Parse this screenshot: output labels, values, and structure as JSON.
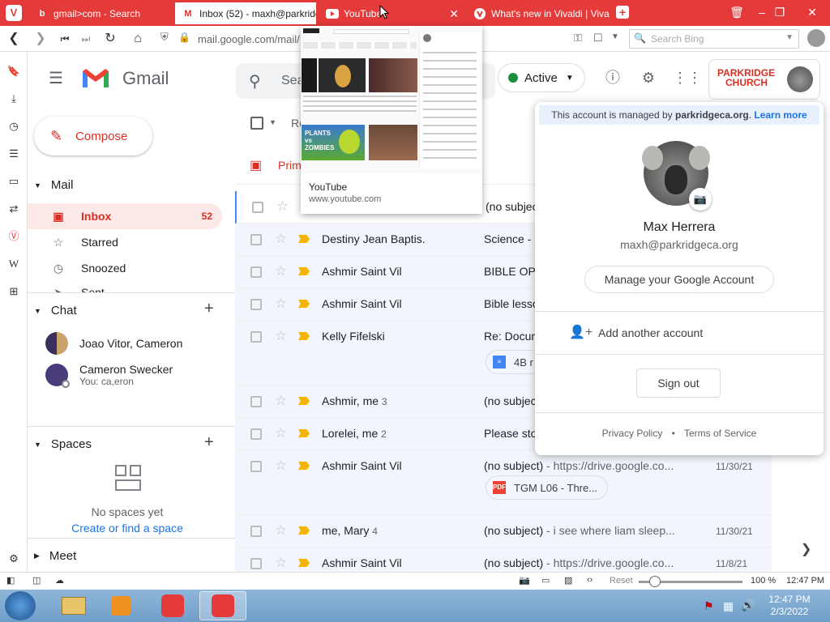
{
  "tabs": [
    {
      "title": "gmail>com - Search",
      "favicon": "bing-icon"
    },
    {
      "title": "Inbox (52) - maxh@parkridg",
      "favicon": "gmail-icon"
    },
    {
      "title": "YouTube",
      "favicon": "youtube-icon"
    },
    {
      "title": "What's new in Vivaldi | Vival",
      "favicon": "vivaldi-icon"
    }
  ],
  "address": {
    "url": "mail.google.com/mail/",
    "search_placeholder": "Search Bing"
  },
  "gmail": {
    "brand": "Gmail",
    "search_placeholder": "Sea",
    "status": "Active",
    "compose": "Compose",
    "mail_section": "Mail",
    "nav": [
      {
        "label": "Inbox",
        "count": "52"
      },
      {
        "label": "Starred",
        "count": ""
      },
      {
        "label": "Snoozed",
        "count": ""
      },
      {
        "label": "Sent",
        "count": ""
      }
    ],
    "chat_section": "Chat",
    "chats": [
      {
        "name": "Joao Vitor, Cameron",
        "preview": ""
      },
      {
        "name": "Cameron Swecker",
        "preview": "You: ca,eron"
      }
    ],
    "spaces_section": "Spaces",
    "spaces_empty": "No spaces yet",
    "spaces_link": "Create or find a space",
    "meet_section": "Meet",
    "toolbar_refresh_fragment": "Re",
    "primary_tab": "Prim"
  },
  "emails": [
    {
      "sender": "",
      "count": "",
      "subject": "(no subjec",
      "preview": "",
      "date": "",
      "important": false
    },
    {
      "sender": "Destiny Jean Baptis.",
      "count": "",
      "subject": "Science - ",
      "preview": "",
      "date": "",
      "important": true
    },
    {
      "sender": "Ashmir Saint Vil",
      "count": "",
      "subject": "BIBLE OPE",
      "preview": "",
      "date": "",
      "important": true
    },
    {
      "sender": "Ashmir Saint Vil",
      "count": "",
      "subject": "Bible lesso",
      "preview": "",
      "date": "",
      "important": true
    },
    {
      "sender": "Kelly Fifelski",
      "count": "",
      "subject": "Re: Docum",
      "preview": "",
      "date": "",
      "important": true,
      "chip": "4B r"
    },
    {
      "sender": "Ashmir, me",
      "count": "3",
      "subject": "(no subjec",
      "preview": "",
      "date": "",
      "important": true
    },
    {
      "sender": "Lorelei, me",
      "count": "2",
      "subject": "Please sto",
      "preview": "",
      "date": "",
      "important": true
    },
    {
      "sender": "Ashmir Saint Vil",
      "count": "",
      "subject": "(no subject)",
      "preview": " - https://drive.google.co...",
      "date": "11/30/21",
      "important": true,
      "chip": "TGM L06 - Thre..."
    },
    {
      "sender": "me, Mary",
      "count": "4",
      "subject": "(no subject)",
      "preview": " - i see where liam sleep...",
      "date": "11/30/21",
      "important": true
    },
    {
      "sender": "Ashmir Saint Vil",
      "count": "",
      "subject": "(no subject)",
      "preview": " - https://drive.google.co...",
      "date": "11/8/21",
      "important": true
    }
  ],
  "account_popup": {
    "managed_prefix": "This account is managed by ",
    "managed_domain": "parkridgeca.org",
    "managed_suffix": ". ",
    "learn_more": "Learn more",
    "name": "Max Herrera",
    "email": "maxh@parkridgeca.org",
    "manage": "Manage your Google Account",
    "add_account": "Add another account",
    "sign_out": "Sign out",
    "privacy": "Privacy Policy",
    "dot": "•",
    "terms": "Terms of Service"
  },
  "header_brand": {
    "line1": "PARKRIDGE",
    "line2": "CHURCH"
  },
  "youtube_preview": {
    "title": "YouTube",
    "url": "www.youtube.com",
    "thumb_label": "PLANTS vs ZOMBIES"
  },
  "status_bar": {
    "reset": "Reset",
    "zoom": "100 %",
    "time": "12:47 PM",
    "zoom_level": 0.16
  },
  "taskbar": {
    "time": "12:47 PM",
    "date": "2/3/2022"
  },
  "colors": {
    "vivaldi_red": "#e43a3a",
    "gmail_red": "#d93025",
    "active_green": "#1e8e3e",
    "important_yellow": "#f4b400"
  }
}
